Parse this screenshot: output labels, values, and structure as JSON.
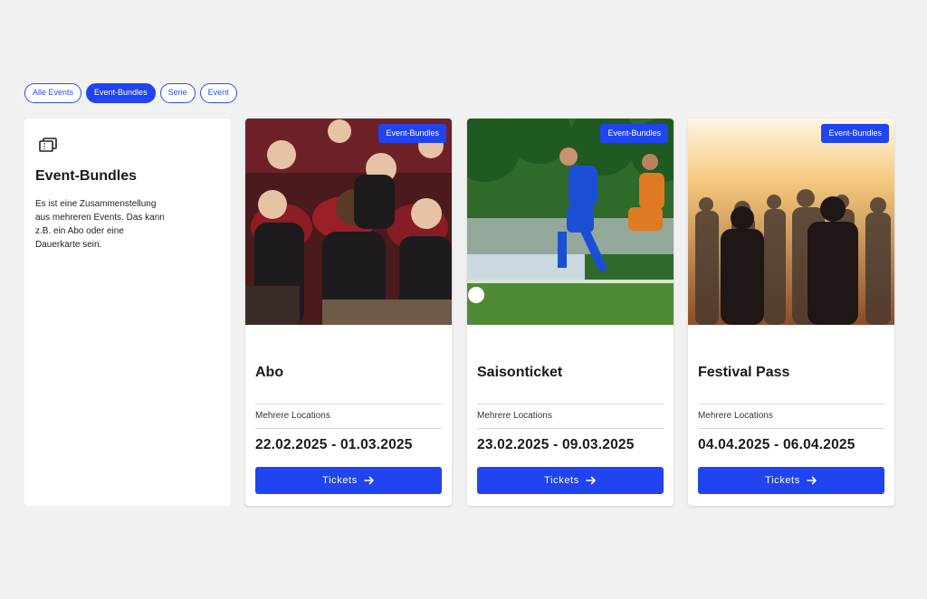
{
  "filters": [
    {
      "label": "Alle Events",
      "active": false
    },
    {
      "label": "Event-Bundles",
      "active": true
    },
    {
      "label": "Serie",
      "active": false
    },
    {
      "label": "Event",
      "active": false
    }
  ],
  "info": {
    "icon": "tickets-icon",
    "title": "Event-Bundles",
    "description": "Es ist eine Zusammenstellung aus mehreren Events. Das kann z.B. ein Abo oder eine Dauerkarte sein."
  },
  "cards": [
    {
      "badge": "Event-Bundles",
      "title": "Abo",
      "location": "Mehrere Locations",
      "dates": "22.02.2025 - 01.03.2025",
      "button": "Tickets"
    },
    {
      "badge": "Event-Bundles",
      "title": "Saisonticket",
      "location": "Mehrere Locations",
      "dates": "23.02.2025 - 09.03.2025",
      "button": "Tickets"
    },
    {
      "badge": "Event-Bundles",
      "title": "Festival Pass",
      "location": "Mehrere Locations",
      "dates": "04.04.2025 - 06.04.2025",
      "button": "Tickets"
    }
  ],
  "colors": {
    "accent": "#1f44f0",
    "background": "#f1f1f1"
  }
}
